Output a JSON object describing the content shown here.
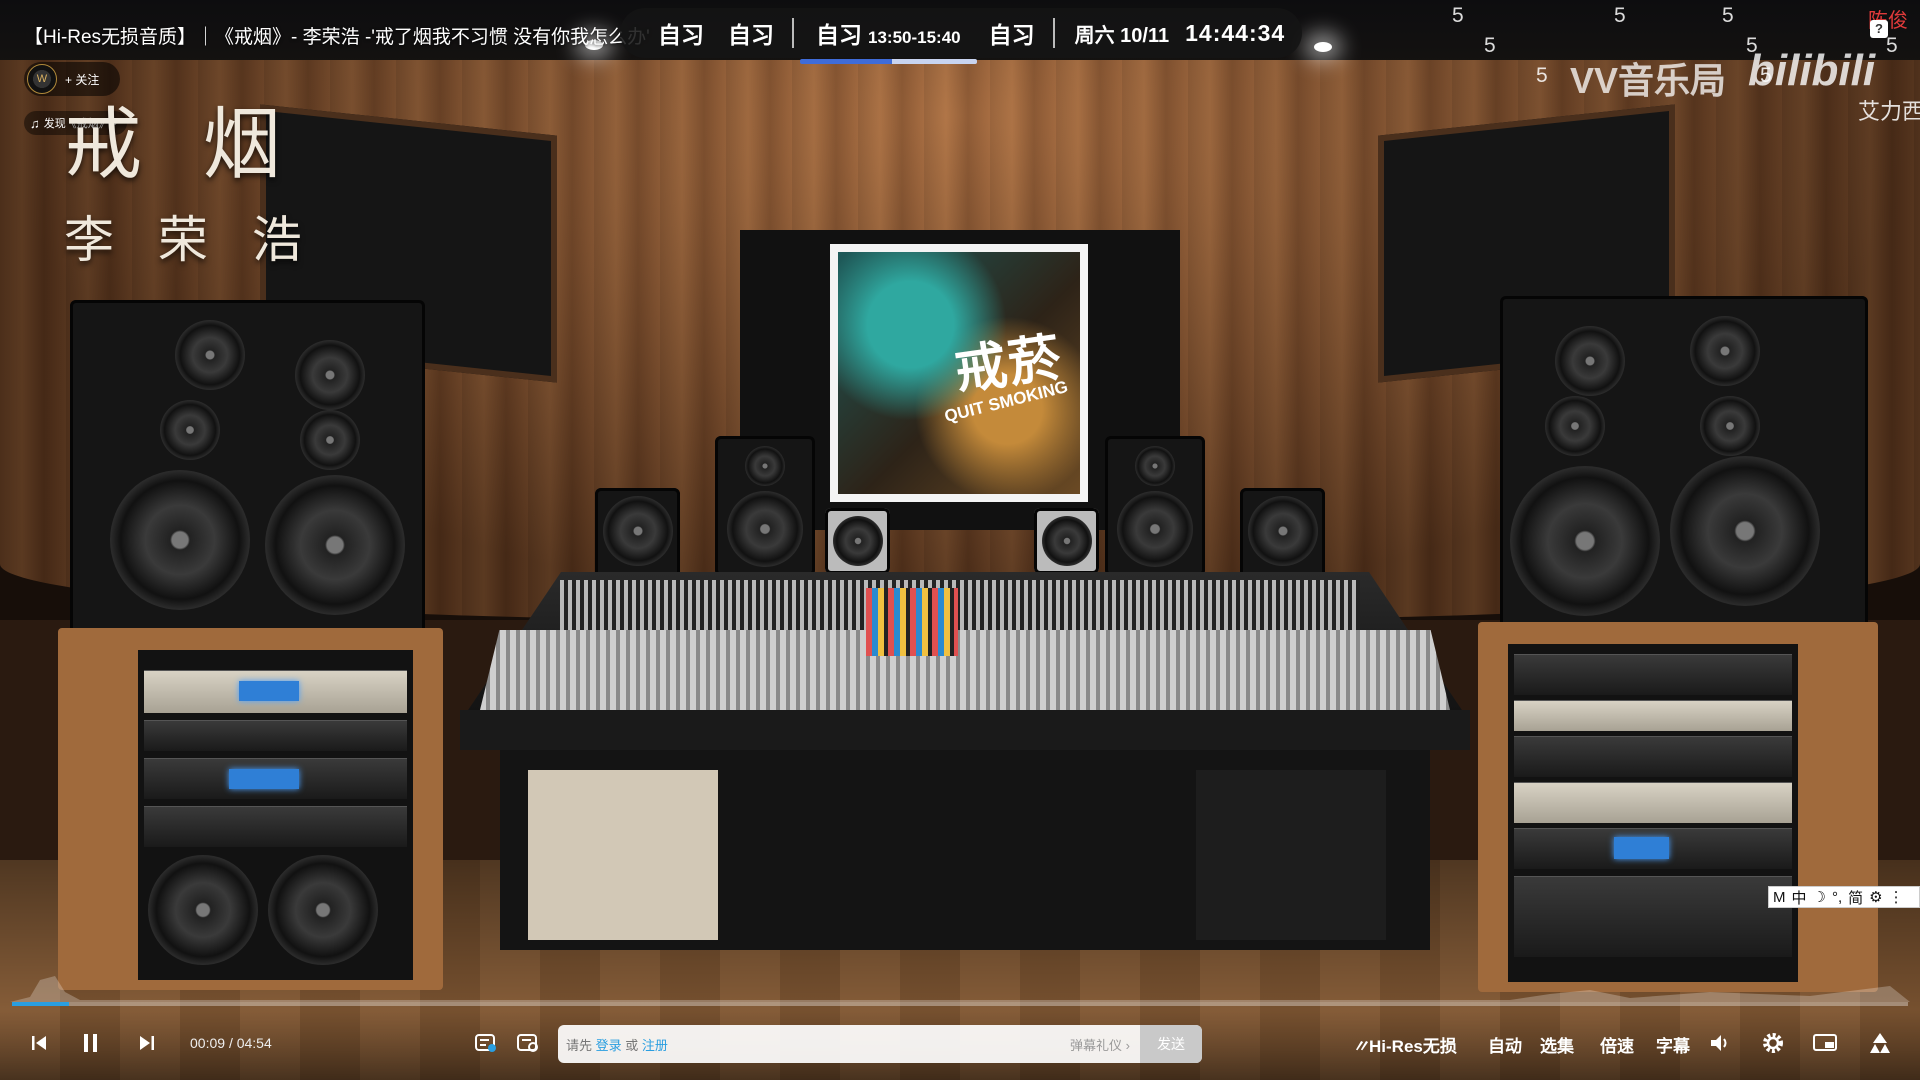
{
  "video": {
    "title": "【Hi-Res无损音质】｜《戒烟》- 李荣浩 -'戒了烟我不习惯 没有你我怎么办'",
    "song_title": "戒 烟",
    "singer": "李 荣 浩",
    "follow_label": "+ 关注",
    "avatar_glyph": "W",
    "discover_label": "发现《戒烟》",
    "album_title": "戒菸",
    "album_subtitle": "QUIT SMOKING"
  },
  "schedule": {
    "slots": [
      "自习",
      "自习"
    ],
    "active_label": "自习",
    "active_time": "13:50-15:40",
    "next_label": "自习",
    "date": "周六 10/11",
    "clock": "14:44:34"
  },
  "overlay": {
    "fives": [
      "5",
      "5",
      "5",
      "5",
      "5",
      "5",
      "5",
      "5"
    ],
    "watermark": "VV音乐局",
    "logo_text": "bilibili",
    "uploader": "艾力西",
    "red_text": "陈俊",
    "help": "?"
  },
  "ime": {
    "items": [
      "M",
      "中",
      "☽",
      "°,",
      "简",
      "⚙",
      "⋮"
    ]
  },
  "player": {
    "current_time": "00:09",
    "separator": "/",
    "duration": "04:54",
    "progress_fraction": 0.03,
    "danmaku_prefix": "请先",
    "danmaku_login": "登录",
    "danmaku_or": "或",
    "danmaku_register": "注册",
    "danmaku_etiquette": "弹幕礼仪 ›",
    "send_label": "发送",
    "hires_label": "Hi-Res无损",
    "quality_label": "自动",
    "episodes_label": "选集",
    "speed_label": "倍速",
    "subtitle_label": "字幕"
  },
  "colors": {
    "accent": "#2a9ee0",
    "schedule_bg": "#141414",
    "active_underline": "#3f6cd8"
  }
}
